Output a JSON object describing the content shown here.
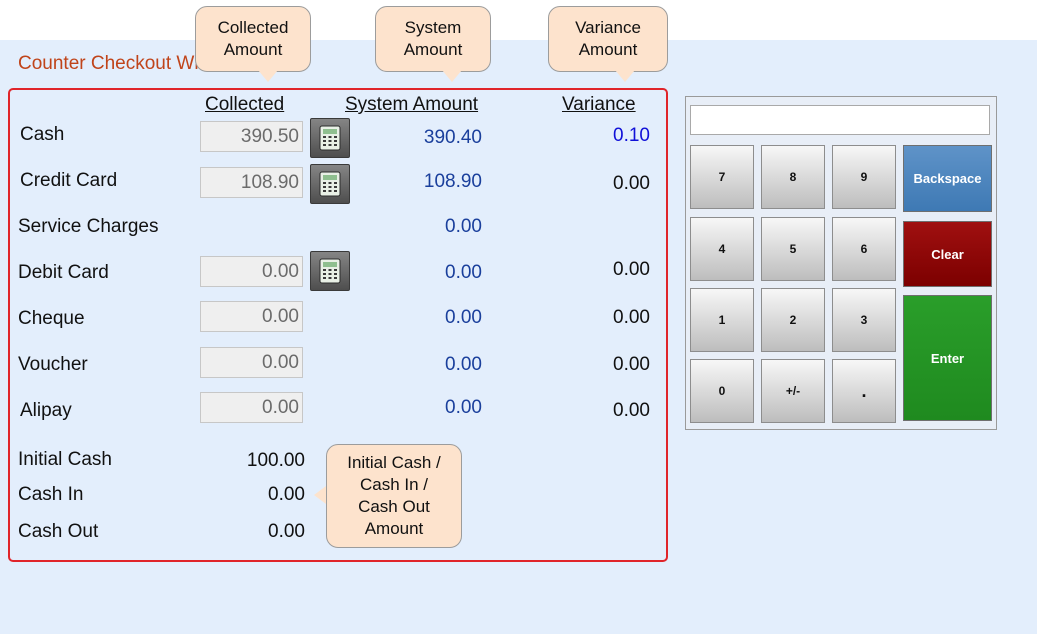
{
  "page": {
    "title": "Counter Checkout Wizard"
  },
  "headers": {
    "collected": "Collected",
    "system": "System Amount",
    "variance": "Variance"
  },
  "rows": [
    {
      "label": "Cash",
      "collected": "390.50",
      "system": "390.40",
      "variance": "0.10"
    },
    {
      "label": "Credit Card",
      "collected": "108.90",
      "system": "108.90",
      "variance": "0.00"
    },
    {
      "label": "Service Charges",
      "system": "0.00"
    },
    {
      "label": "Debit Card",
      "collected": "0.00",
      "system": "0.00",
      "variance": "0.00"
    },
    {
      "label": "Cheque",
      "collected": "0.00",
      "system": "0.00",
      "variance": "0.00"
    },
    {
      "label": "Voucher",
      "collected": "0.00",
      "system": "0.00",
      "variance": "0.00"
    },
    {
      "label": "Alipay",
      "collected": "0.00",
      "system": "0.00",
      "variance": "0.00"
    }
  ],
  "cash_summary": [
    {
      "label": "Initial Cash",
      "value": "100.00"
    },
    {
      "label": "Cash In",
      "value": "0.00"
    },
    {
      "label": "Cash Out",
      "value": "0.00"
    }
  ],
  "callouts": {
    "collected": [
      "Collected",
      "Amount"
    ],
    "system": [
      "System",
      "Amount"
    ],
    "variance": [
      "Variance",
      "Amount"
    ],
    "cash": [
      "Initial Cash /",
      "Cash In /",
      "Cash Out",
      "Amount"
    ]
  },
  "keypad": {
    "keys": [
      "7",
      "8",
      "9",
      "4",
      "5",
      "6",
      "1",
      "2",
      "3",
      "0",
      "+/-",
      "."
    ],
    "backspace": "Backspace",
    "clear": "Clear",
    "enter": "Enter"
  },
  "colors": {
    "title": "#c0441a",
    "system_amount": "#1a3f9c",
    "variance_positive": "#1010d8",
    "panel_border": "#e0242a",
    "callout_bg": "#fde3cd",
    "backspace": "#4a83bd",
    "clear": "#8b0000",
    "enter": "#239123"
  }
}
